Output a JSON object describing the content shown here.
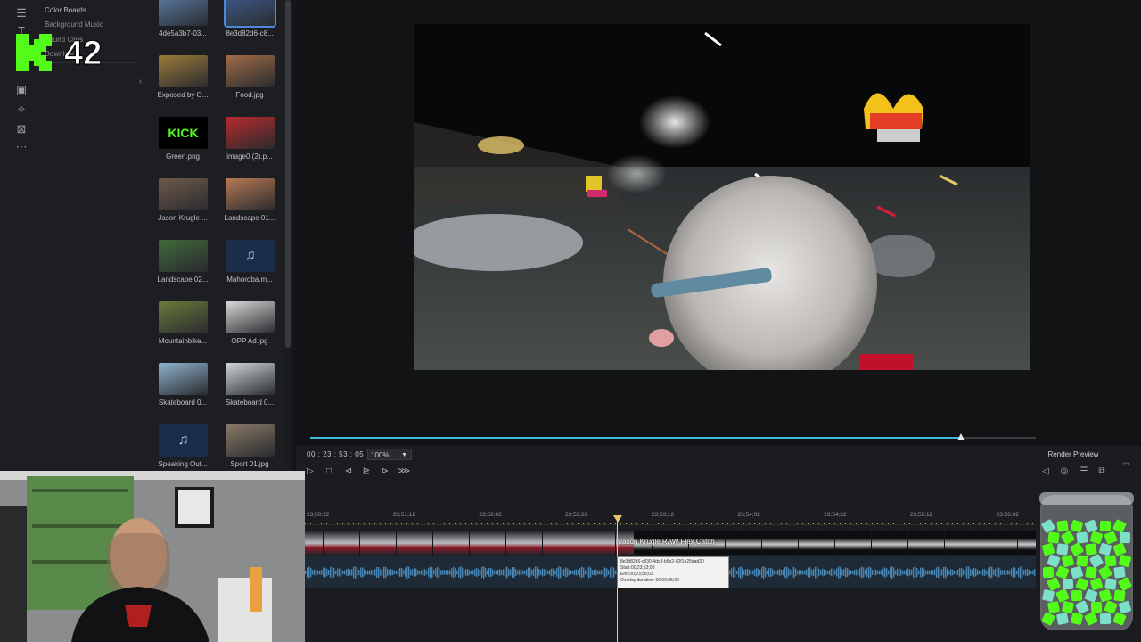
{
  "categories": [
    "Color Boards",
    "Background Music",
    "Sound Clips",
    "Downloads"
  ],
  "media": [
    {
      "label": "4de5a3b7-03...",
      "kind": "image",
      "color": "#5b7fa6"
    },
    {
      "label": "8e3d82d6-c8...",
      "kind": "image",
      "color": "#3e5d8f"
    },
    {
      "label": "Exposed by O...",
      "kind": "image",
      "color": "#9b7b3a"
    },
    {
      "label": "Food.jpg",
      "kind": "image",
      "color": "#a26c48"
    },
    {
      "label": "Green.png",
      "kind": "kick",
      "color": "#000000",
      "text": "KICK"
    },
    {
      "label": "image0 (2).p...",
      "kind": "image",
      "color": "#b82a2a"
    },
    {
      "label": "Jason Krugle ...",
      "kind": "image",
      "color": "#6e5a4a"
    },
    {
      "label": "Landscape 01...",
      "kind": "image",
      "color": "#b77a54"
    },
    {
      "label": "Landscape 02...",
      "kind": "image",
      "color": "#3f6a3a"
    },
    {
      "label": "Mahoroba.m...",
      "kind": "music",
      "color": "#1a2e4a"
    },
    {
      "label": "Mountainbike...",
      "kind": "image",
      "color": "#6a7a3a"
    },
    {
      "label": "OPP Ad.jpg",
      "kind": "image",
      "color": "#d8d8d8"
    },
    {
      "label": "Skateboard 0...",
      "kind": "image",
      "color": "#8fb3cf"
    },
    {
      "label": "Skateboard 0...",
      "kind": "image",
      "color": "#cfd6dc"
    },
    {
      "label": "Speaking Out...",
      "kind": "music",
      "color": "#1a2e4a"
    },
    {
      "label": "Sport 01.jpg",
      "kind": "image",
      "color": "#8a7a68"
    }
  ],
  "preview": {
    "timecode": "00 ; 23 ; 53 ; 05",
    "zoom": "100%",
    "render_label": "Render Preview",
    "scrub_progress": 0.86
  },
  "timeline": {
    "ticks": [
      "23;50;22",
      "23;51;12",
      "23;52;02",
      "23;52;22",
      "23;53;12",
      "23;54;02",
      "23;54;22",
      "23;55;12",
      "23;56;02"
    ],
    "clip_label": "Jason Krugle RAW Flex Catch",
    "tooltip": [
      "8e3d82d6-c830-4dc3-b6e2-02f1e25dad30",
      "Start:00;23;53;03",
      "End:00;23;58;03",
      "Overlay duration: 00;00;05;00"
    ]
  },
  "overlay": {
    "k42_letter": "K",
    "k42_number": "42"
  },
  "colors": {
    "accent": "#3fb7d8",
    "kick_green": "#53fc18",
    "playhead": "#e6c56b"
  }
}
